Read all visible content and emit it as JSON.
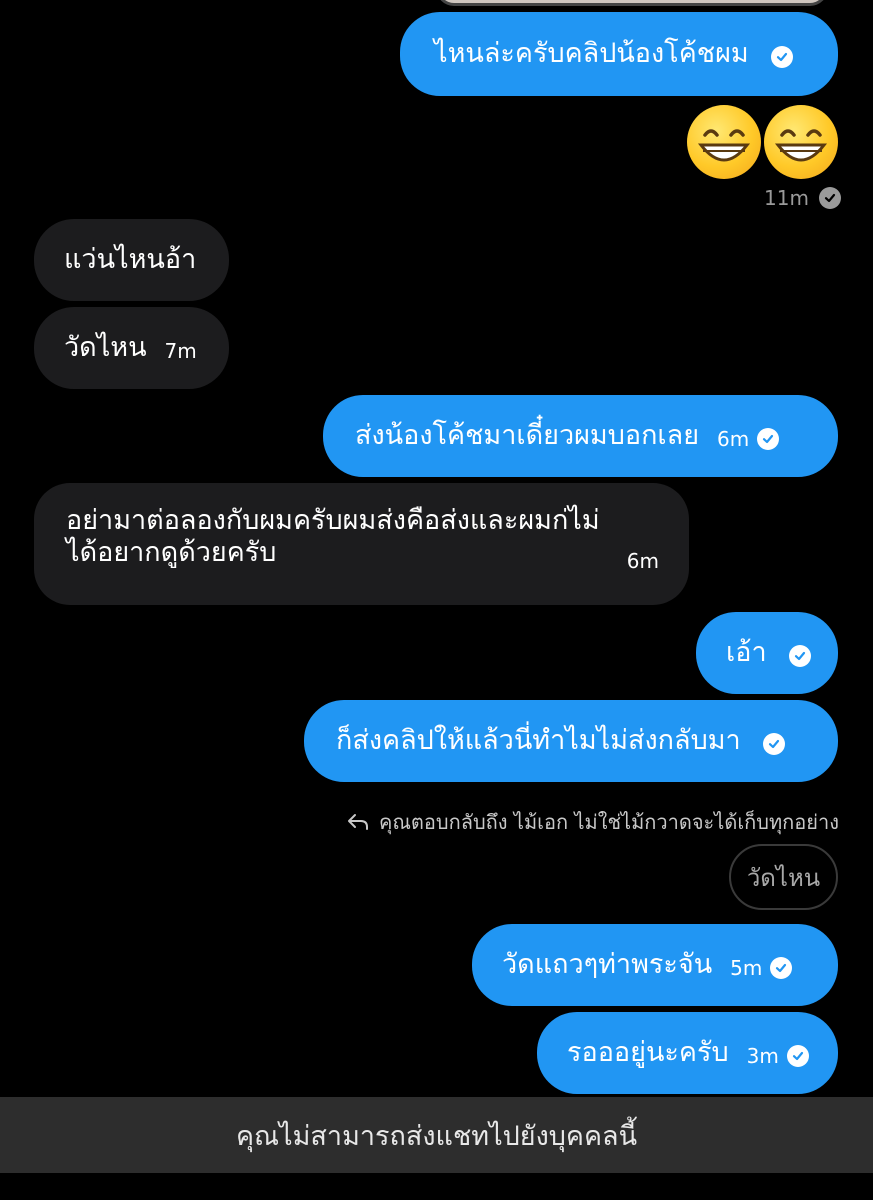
{
  "messages": [
    {
      "text": "ไหนล่ะครับคลิปน้องโค้ชผม",
      "time": ""
    },
    {
      "text": "",
      "time": "11m"
    },
    {
      "text": "แว่นไหนอ้า",
      "time": ""
    },
    {
      "text": "วัดไหน",
      "time": "7m"
    },
    {
      "text": "ส่งน้องโค้ชมาเดี๋ยวผมบอกเลย",
      "time": "6m"
    },
    {
      "text_line1": "อย่ามาต่อลองกับผมครับผมส่งคือส่งและผมก่ไม่",
      "text_line2": "ได้อยากดูด้วยครับ",
      "time": "6m"
    },
    {
      "text": "เอ้า",
      "time": ""
    },
    {
      "text": "ก็ส่งคลิปให้แล้วนี่ทำไมไม่ส่งกลับมา",
      "time": ""
    },
    {
      "text": "วัดแถวๆท่าพระจัน",
      "time": "5m"
    },
    {
      "text": "รอออยู่นะครับ",
      "time": "3m"
    }
  ],
  "reply": {
    "note": "คุณตอบกลับถึง ไม้เอก ไม่ใช่ไม้กวาดจะได้เก็บทุกอย่าง",
    "quoted": "วัดไหน"
  },
  "footer": {
    "text": "คุณไม่สามารถส่งแชทไปยังบุคคลนี้"
  },
  "colors": {
    "outgoing": "#2196f3",
    "incoming": "#1c1c1e",
    "background": "#000000",
    "footer": "#2d2d2d"
  },
  "icons": {
    "seen": "check-circle-icon",
    "reply": "reply-arrow-icon",
    "emoji": "grinning-face-emoji"
  }
}
